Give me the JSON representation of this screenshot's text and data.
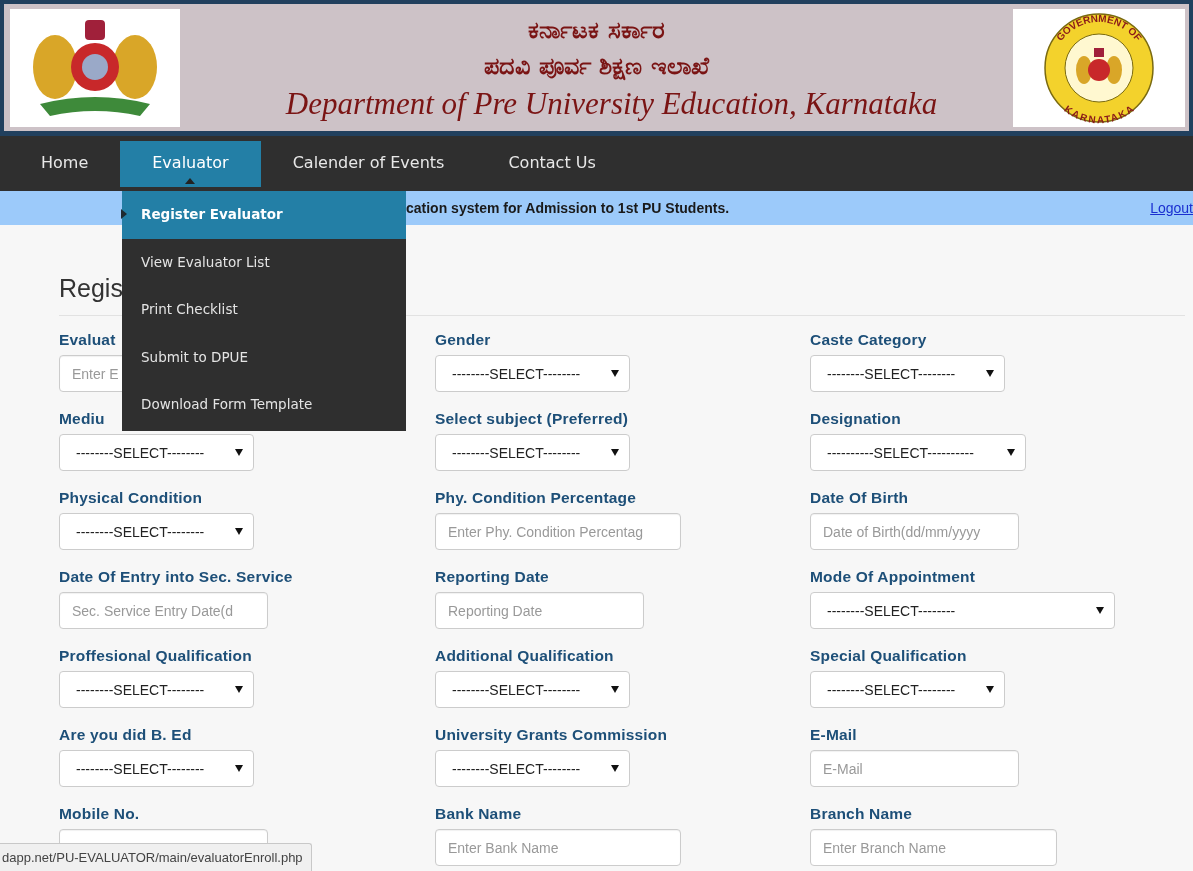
{
  "header": {
    "kannada_lines": [
      "ಕರ್ನಾಟಕ ಸರ್ಕಾರ",
      "ಪದವಿ ಪೂರ್ವ ಶಿಕ್ಷಣ ಇಲಾಖೆ"
    ],
    "title": "Department of Pre University Education, Karnataka",
    "seal_top": "GOVERNMENT OF",
    "seal_bottom": "KARNATAKA"
  },
  "nav": [
    {
      "label": "Home",
      "selected": false
    },
    {
      "label": "Evaluator",
      "selected": true
    },
    {
      "label": "Calender of Events",
      "selected": false
    },
    {
      "label": "Contact Us",
      "selected": false
    }
  ],
  "menu": [
    {
      "label": "Register Evaluator",
      "selected": true
    },
    {
      "label": "View Evaluator List",
      "selected": false
    },
    {
      "label": "Print Checklist",
      "selected": false
    },
    {
      "label": "Submit to DPUE",
      "selected": false
    },
    {
      "label": "Download Form Template",
      "selected": false
    }
  ],
  "notice": {
    "text": "cation system for Admission to 1st PU Students.",
    "logout": "Logout"
  },
  "heading": "Regis",
  "fields": [
    {
      "label": "Evaluat",
      "kind": "input",
      "placeholder": "Enter E"
    },
    {
      "label": "Gender",
      "kind": "select",
      "value": "--------SELECT--------"
    },
    {
      "label": "Caste Category",
      "kind": "select",
      "value": "--------SELECT--------"
    },
    {
      "label": "Mediu",
      "kind": "select",
      "value": "--------SELECT--------"
    },
    {
      "label": "Select subject (Preferred)",
      "kind": "select",
      "value": "--------SELECT--------"
    },
    {
      "label": "Designation",
      "kind": "select",
      "value": "----------SELECT----------"
    },
    {
      "label": "Physical Condition",
      "kind": "select",
      "value": "--------SELECT--------"
    },
    {
      "label": "Phy. Condition Percentage",
      "kind": "input",
      "placeholder": "Enter Phy. Condition Percentag"
    },
    {
      "label": "Date Of Birth",
      "kind": "input",
      "placeholder": "Date of Birth(dd/mm/yyyy"
    },
    {
      "label": "Date Of Entry into Sec. Service",
      "kind": "input",
      "placeholder": "Sec. Service Entry Date(d"
    },
    {
      "label": "Reporting Date",
      "kind": "input",
      "placeholder": "Reporting Date"
    },
    {
      "label": "Mode Of Appointment",
      "kind": "select",
      "value": "--------SELECT--------"
    },
    {
      "label": "Proffesional Qualification",
      "kind": "select",
      "value": "--------SELECT--------"
    },
    {
      "label": "Additional Qualification",
      "kind": "select",
      "value": "--------SELECT--------"
    },
    {
      "label": "Special Qualification",
      "kind": "select",
      "value": "--------SELECT--------"
    },
    {
      "label": "Are you did B. Ed",
      "kind": "select",
      "value": "--------SELECT--------"
    },
    {
      "label": "University Grants Commission",
      "kind": "select",
      "value": "--------SELECT--------"
    },
    {
      "label": "E-Mail",
      "kind": "input",
      "placeholder": "E-Mail"
    },
    {
      "label": "Mobile No.",
      "kind": "input"
    },
    {
      "label": "Bank Name",
      "kind": "input",
      "placeholder": "Enter Bank Name"
    },
    {
      "label": "Branch Name",
      "kind": "input",
      "placeholder": "Enter Branch Name"
    }
  ],
  "status_bar": "dapp.net/PU-EVALUATOR/main/evaluatorEnroll.php"
}
